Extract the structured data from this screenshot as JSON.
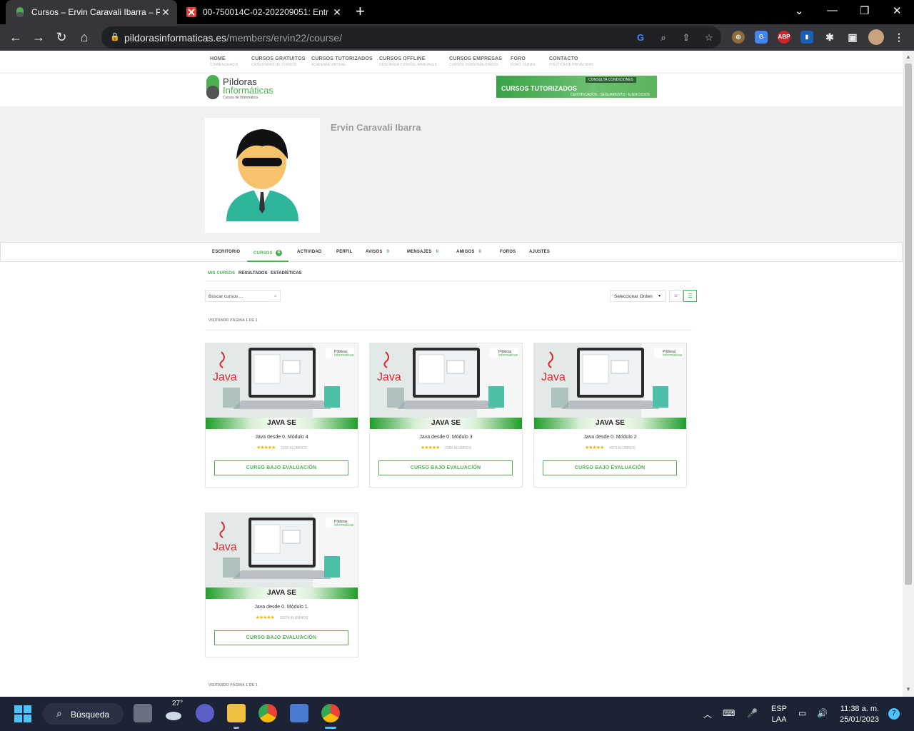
{
  "browser": {
    "tabs": [
      {
        "title": "Cursos – Ervin Caravali Ibarra – Pí",
        "active": true
      },
      {
        "title": "00-750014C-02-202209051: Entr",
        "active": false
      }
    ],
    "url_domain": "pildorasinformaticas.es",
    "url_path": "/members/ervin22/course/",
    "extensions": [
      "ABP"
    ]
  },
  "site": {
    "topnav": [
      {
        "label": "HOME",
        "sub": "COMIENZA AQUÍ"
      },
      {
        "label": "CURSOS GRATUITOS",
        "sub": "CATEGORÍAS DE CURSOS"
      },
      {
        "label": "CURSOS TUTORIZADOS",
        "sub": "ACADEMIA VIRTUAL"
      },
      {
        "label": "CURSOS OFFLINE",
        "sub": "DESCARGA CURSOS, MANUALES"
      },
      {
        "label": "CURSOS EMPRESAS",
        "sub": "CURSOS PERSONALIZADOS"
      },
      {
        "label": "FORO",
        "sub": "FORO, DUDAS"
      },
      {
        "label": "CONTACTO",
        "sub": "POLÍTICA DE PRIVACIDAD"
      }
    ],
    "logo": {
      "line1": "Píldoras",
      "line2": "Informáticas",
      "tagline": "Cursos de Informática"
    },
    "banner": {
      "title": "CURSOS TUTORIZADOS",
      "tag": "CONSULTA CONDICIONES",
      "sub": "CERTIFICADOS - SEGUIMIENTO - EJERCICIOS"
    }
  },
  "profile": {
    "name": "Ervin Caravali Ibarra"
  },
  "subnav": [
    {
      "label": "ESCRITORIO"
    },
    {
      "label": "CURSOS",
      "badge": "4",
      "active": true
    },
    {
      "label": "ACTIVIDAD"
    },
    {
      "label": "PERFIL"
    },
    {
      "label": "AVISOS",
      "count": "0"
    },
    {
      "label": "MENSAJES",
      "count": "0"
    },
    {
      "label": "AMIGOS",
      "count": "0"
    },
    {
      "label": "FOROS"
    },
    {
      "label": "AJUSTES"
    }
  ],
  "courseTabs": [
    {
      "label": "MIS CURSOS",
      "active": true
    },
    {
      "label": "RESULTADOS"
    },
    {
      "label": "ESTADÍSTICAS"
    }
  ],
  "search": {
    "placeholder": "Buscar cursos ..."
  },
  "order": {
    "label": "Seleccionar Orden"
  },
  "pagination": {
    "top": "VISITANDO PÁGINA 1 DE 1",
    "bottom": "VISITANDO PÁGINA 1 DE 1"
  },
  "courses": [
    {
      "banner": "JAVA SE",
      "title": "Java desde 0. Módulo 4",
      "students": "3192 ALUMNOS",
      "stars": "★★★★★",
      "button": "CURSO BAJO EVALUACIÓN",
      "rating": 5
    },
    {
      "banner": "JAVA SE",
      "title": "Java desde 0. Módulo 3",
      "students": "2984 ALUMNOS",
      "stars": "★★★★★",
      "button": "CURSO BAJO EVALUACIÓN",
      "rating": 5
    },
    {
      "banner": "JAVA SE",
      "title": "Java desde 0. Módulo 2",
      "students": "4373 ALUMNOS",
      "stars": "★★★★★",
      "button": "CURSO BAJO EVALUACIÓN",
      "rating": 5
    },
    {
      "banner": "JAVA SE",
      "title": "Java desde 0. Módulo 1.",
      "students": "15074 ALUMNOS",
      "stars": "★★★★★",
      "button": "CURSO BAJO EVALUACIÓN",
      "rating": 5
    }
  ],
  "taskbar": {
    "search": "Búsqueda",
    "weather": "27°",
    "lang1": "ESP",
    "lang2": "LAA",
    "time": "11:38 a. m.",
    "date": "25/01/2023",
    "notif": "7"
  }
}
